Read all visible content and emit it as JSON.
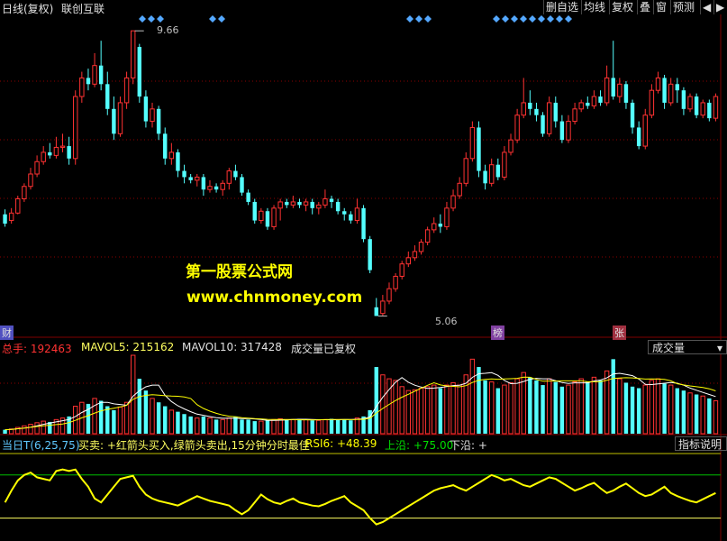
{
  "header": {
    "title": "日线(复权)",
    "stock_name": "联创互联",
    "buttons": [
      "删自选",
      "均线",
      "复权",
      "叠",
      "窗",
      "预测"
    ],
    "arrow_left": "◀",
    "arrow_right": "▶"
  },
  "watermark": {
    "line1": "第一股票公式网",
    "line2": "www.chnmoney.com"
  },
  "price_labels": {
    "high": "9.66",
    "low": "5.06"
  },
  "tags": {
    "cai": "财",
    "bang": "榜",
    "zhang": "张"
  },
  "volume_info": {
    "total_label": "总手: 192463",
    "mavol5_label": "MAVOL5: 215162",
    "mavol10_label": "MAVOL10: 317428",
    "note": "成交量已复权",
    "dropdown_value": "成交量"
  },
  "indicator_info": {
    "name": "当日T(6,25,75)",
    "desc": "买卖: +红箭头买入,绿箭头卖出,15分钟分时最佳",
    "rsi": "RSI6: +48.39",
    "upper": "上沿: +75.00",
    "lower": "下沿: +",
    "explain_button": "指标说明"
  },
  "colors": {
    "up": "#ff3232",
    "down": "#54ffff",
    "ma5": "#ffffff",
    "ma10": "#ffff00",
    "rsi_line": "#ffff00",
    "upper_line": "#00c000",
    "lower_line": "#ffff60",
    "diamond": "#54a8ff",
    "grid": "#8b0000"
  },
  "chart_data": {
    "type": "candlestick",
    "price_range": [
      4.8,
      10.0
    ],
    "y_high_label": 9.66,
    "y_low_label": 5.06,
    "candles": [
      [
        6.7,
        6.55,
        6.78,
        6.5
      ],
      [
        6.6,
        6.72,
        6.8,
        6.55
      ],
      [
        6.72,
        6.95,
        7.0,
        6.7
      ],
      [
        6.95,
        7.15,
        7.2,
        6.9
      ],
      [
        7.15,
        7.35,
        7.45,
        7.1
      ],
      [
        7.35,
        7.55,
        7.65,
        7.3
      ],
      [
        7.55,
        7.7,
        7.8,
        7.5
      ],
      [
        7.7,
        7.65,
        7.85,
        7.6
      ],
      [
        7.65,
        7.78,
        7.95,
        7.6
      ],
      [
        7.78,
        7.8,
        8.0,
        7.7
      ],
      [
        7.8,
        7.6,
        7.95,
        7.5
      ],
      [
        7.6,
        8.6,
        8.7,
        7.5
      ],
      [
        8.6,
        8.9,
        9.0,
        8.5
      ],
      [
        8.9,
        8.8,
        9.05,
        8.7
      ],
      [
        8.8,
        9.1,
        9.3,
        8.75
      ],
      [
        9.1,
        8.8,
        9.5,
        8.7
      ],
      [
        8.8,
        8.4,
        9.0,
        8.3
      ],
      [
        8.4,
        8.0,
        8.6,
        7.9
      ],
      [
        8.0,
        8.5,
        8.6,
        7.95
      ],
      [
        8.5,
        8.9,
        9.0,
        8.4
      ],
      [
        8.9,
        9.66,
        9.66,
        8.8
      ],
      [
        9.4,
        8.6,
        9.45,
        8.5
      ],
      [
        8.6,
        8.2,
        8.7,
        8.1
      ],
      [
        8.2,
        8.4,
        8.5,
        8.1
      ],
      [
        8.4,
        8.0,
        8.45,
        7.9
      ],
      [
        8.0,
        7.6,
        8.1,
        7.5
      ],
      [
        7.6,
        7.7,
        7.85,
        7.5
      ],
      [
        7.7,
        7.4,
        7.75,
        7.3
      ],
      [
        7.4,
        7.3,
        7.5,
        7.2
      ],
      [
        7.3,
        7.25,
        7.35,
        7.2
      ],
      [
        7.25,
        7.3,
        7.35,
        7.15
      ],
      [
        7.3,
        7.1,
        7.35,
        7.0
      ],
      [
        7.1,
        7.15,
        7.25,
        7.05
      ],
      [
        7.15,
        7.1,
        7.2,
        7.05
      ],
      [
        7.1,
        7.2,
        7.25,
        7.0
      ],
      [
        7.2,
        7.4,
        7.45,
        7.1
      ],
      [
        7.4,
        7.3,
        7.5,
        7.25
      ],
      [
        7.3,
        7.05,
        7.35,
        7.0
      ],
      [
        7.05,
        6.9,
        7.1,
        6.85
      ],
      [
        6.9,
        6.6,
        6.95,
        6.55
      ],
      [
        6.6,
        6.75,
        6.8,
        6.55
      ],
      [
        6.75,
        6.5,
        6.8,
        6.45
      ],
      [
        6.5,
        6.8,
        6.85,
        6.45
      ],
      [
        6.8,
        6.9,
        6.95,
        6.6
      ],
      [
        6.9,
        6.85,
        6.95,
        6.8
      ],
      [
        6.85,
        6.9,
        7.0,
        6.8
      ],
      [
        6.9,
        6.85,
        6.95,
        6.8
      ],
      [
        6.85,
        6.9,
        6.95,
        6.75
      ],
      [
        6.9,
        6.8,
        6.95,
        6.7
      ],
      [
        6.8,
        6.85,
        6.9,
        6.7
      ],
      [
        6.85,
        6.95,
        7.1,
        6.8
      ],
      [
        6.95,
        6.9,
        7.0,
        6.8
      ],
      [
        6.9,
        6.75,
        6.95,
        6.7
      ],
      [
        6.75,
        6.7,
        6.8,
        6.6
      ],
      [
        6.7,
        6.6,
        6.75,
        6.55
      ],
      [
        6.6,
        6.8,
        6.95,
        6.55
      ],
      [
        6.8,
        6.3,
        6.85,
        6.25
      ],
      [
        6.3,
        5.8,
        6.35,
        5.75
      ],
      [
        5.2,
        5.06,
        5.35,
        5.06
      ],
      [
        5.1,
        5.3,
        5.4,
        5.06
      ],
      [
        5.3,
        5.5,
        5.6,
        5.25
      ],
      [
        5.5,
        5.7,
        5.75,
        5.45
      ],
      [
        5.7,
        5.9,
        5.95,
        5.65
      ],
      [
        5.9,
        6.0,
        6.1,
        5.85
      ],
      [
        6.0,
        6.1,
        6.2,
        5.95
      ],
      [
        6.1,
        6.25,
        6.3,
        6.05
      ],
      [
        6.25,
        6.45,
        6.5,
        6.2
      ],
      [
        6.45,
        6.55,
        6.65,
        6.4
      ],
      [
        6.55,
        6.5,
        6.7,
        6.4
      ],
      [
        6.5,
        6.8,
        6.9,
        6.45
      ],
      [
        6.8,
        7.0,
        7.1,
        6.75
      ],
      [
        7.0,
        7.2,
        7.3,
        6.95
      ],
      [
        7.2,
        7.6,
        7.7,
        7.15
      ],
      [
        7.6,
        8.1,
        8.2,
        7.55
      ],
      [
        8.1,
        7.4,
        8.2,
        7.3
      ],
      [
        7.4,
        7.2,
        7.5,
        7.1
      ],
      [
        7.2,
        7.5,
        7.6,
        7.15
      ],
      [
        7.5,
        7.3,
        7.6,
        7.25
      ],
      [
        7.3,
        7.7,
        7.8,
        7.25
      ],
      [
        7.7,
        7.9,
        8.0,
        7.65
      ],
      [
        7.9,
        8.3,
        8.4,
        7.85
      ],
      [
        8.3,
        8.5,
        8.9,
        8.25
      ],
      [
        8.5,
        8.4,
        8.7,
        8.3
      ],
      [
        8.4,
        8.3,
        8.5,
        8.2
      ],
      [
        8.3,
        8.0,
        8.35,
        7.95
      ],
      [
        8.0,
        8.5,
        8.6,
        7.95
      ],
      [
        8.5,
        8.2,
        8.6,
        8.1
      ],
      [
        8.2,
        7.9,
        8.3,
        7.85
      ],
      [
        7.9,
        8.2,
        8.3,
        7.85
      ],
      [
        8.2,
        8.4,
        8.5,
        8.15
      ],
      [
        8.4,
        8.5,
        8.55,
        8.35
      ],
      [
        8.5,
        8.45,
        8.6,
        8.4
      ],
      [
        8.45,
        8.6,
        8.7,
        8.4
      ],
      [
        8.6,
        8.5,
        8.7,
        8.45
      ],
      [
        8.5,
        8.9,
        9.1,
        8.45
      ],
      [
        8.9,
        8.6,
        9.5,
        8.55
      ],
      [
        8.6,
        8.8,
        8.9,
        8.5
      ],
      [
        8.8,
        8.5,
        8.85,
        8.4
      ],
      [
        8.5,
        8.1,
        8.55,
        8.0
      ],
      [
        8.1,
        7.8,
        8.2,
        7.75
      ],
      [
        7.8,
        8.3,
        8.4,
        7.75
      ],
      [
        8.3,
        8.7,
        8.8,
        8.25
      ],
      [
        8.7,
        8.9,
        9.0,
        8.65
      ],
      [
        8.9,
        8.5,
        8.95,
        8.4
      ],
      [
        8.5,
        8.8,
        8.9,
        8.45
      ],
      [
        8.8,
        8.7,
        8.9,
        8.5
      ],
      [
        8.7,
        8.4,
        8.75,
        8.3
      ],
      [
        8.4,
        8.6,
        8.65,
        8.35
      ],
      [
        8.6,
        8.3,
        8.65,
        8.25
      ],
      [
        8.3,
        8.5,
        8.55,
        8.25
      ],
      [
        8.5,
        8.25,
        8.55,
        8.2
      ],
      [
        8.25,
        8.6,
        8.65,
        8.2
      ]
    ],
    "volume": [
      5,
      6,
      8,
      10,
      12,
      14,
      16,
      15,
      18,
      20,
      22,
      35,
      40,
      38,
      45,
      42,
      35,
      30,
      34,
      40,
      100,
      70,
      55,
      45,
      40,
      35,
      30,
      28,
      25,
      22,
      20,
      22,
      20,
      18,
      18,
      20,
      22,
      18,
      18,
      16,
      16,
      17,
      18,
      19,
      18,
      18,
      19,
      18,
      17,
      17,
      18,
      19,
      18,
      18,
      17,
      20,
      22,
      30,
      85,
      75,
      70,
      68,
      60,
      55,
      56,
      58,
      60,
      62,
      58,
      62,
      65,
      62,
      75,
      95,
      85,
      68,
      66,
      58,
      62,
      65,
      70,
      78,
      72,
      68,
      62,
      70,
      66,
      60,
      62,
      66,
      70,
      66,
      72,
      68,
      80,
      95,
      70,
      65,
      60,
      58,
      62,
      68,
      70,
      64,
      62,
      58,
      55,
      52,
      50,
      48,
      45,
      42
    ],
    "rsi": [
      40,
      55,
      68,
      75,
      78,
      72,
      70,
      68,
      80,
      82,
      80,
      82,
      70,
      60,
      45,
      40,
      50,
      60,
      70,
      72,
      74,
      60,
      50,
      45,
      42,
      40,
      38,
      36,
      40,
      44,
      48,
      45,
      42,
      40,
      38,
      36,
      30,
      25,
      30,
      40,
      50,
      44,
      40,
      38,
      42,
      45,
      40,
      38,
      36,
      35,
      38,
      42,
      45,
      48,
      40,
      35,
      30,
      20,
      12,
      15,
      20,
      25,
      30,
      35,
      40,
      45,
      50,
      55,
      58,
      60,
      62,
      58,
      55,
      60,
      65,
      70,
      75,
      72,
      68,
      70,
      66,
      62,
      60,
      64,
      68,
      72,
      70,
      65,
      60,
      55,
      58,
      62,
      65,
      58,
      52,
      55,
      60,
      64,
      58,
      52,
      48,
      50,
      55,
      60,
      52,
      48,
      45,
      42,
      40,
      44,
      48,
      52
    ]
  }
}
